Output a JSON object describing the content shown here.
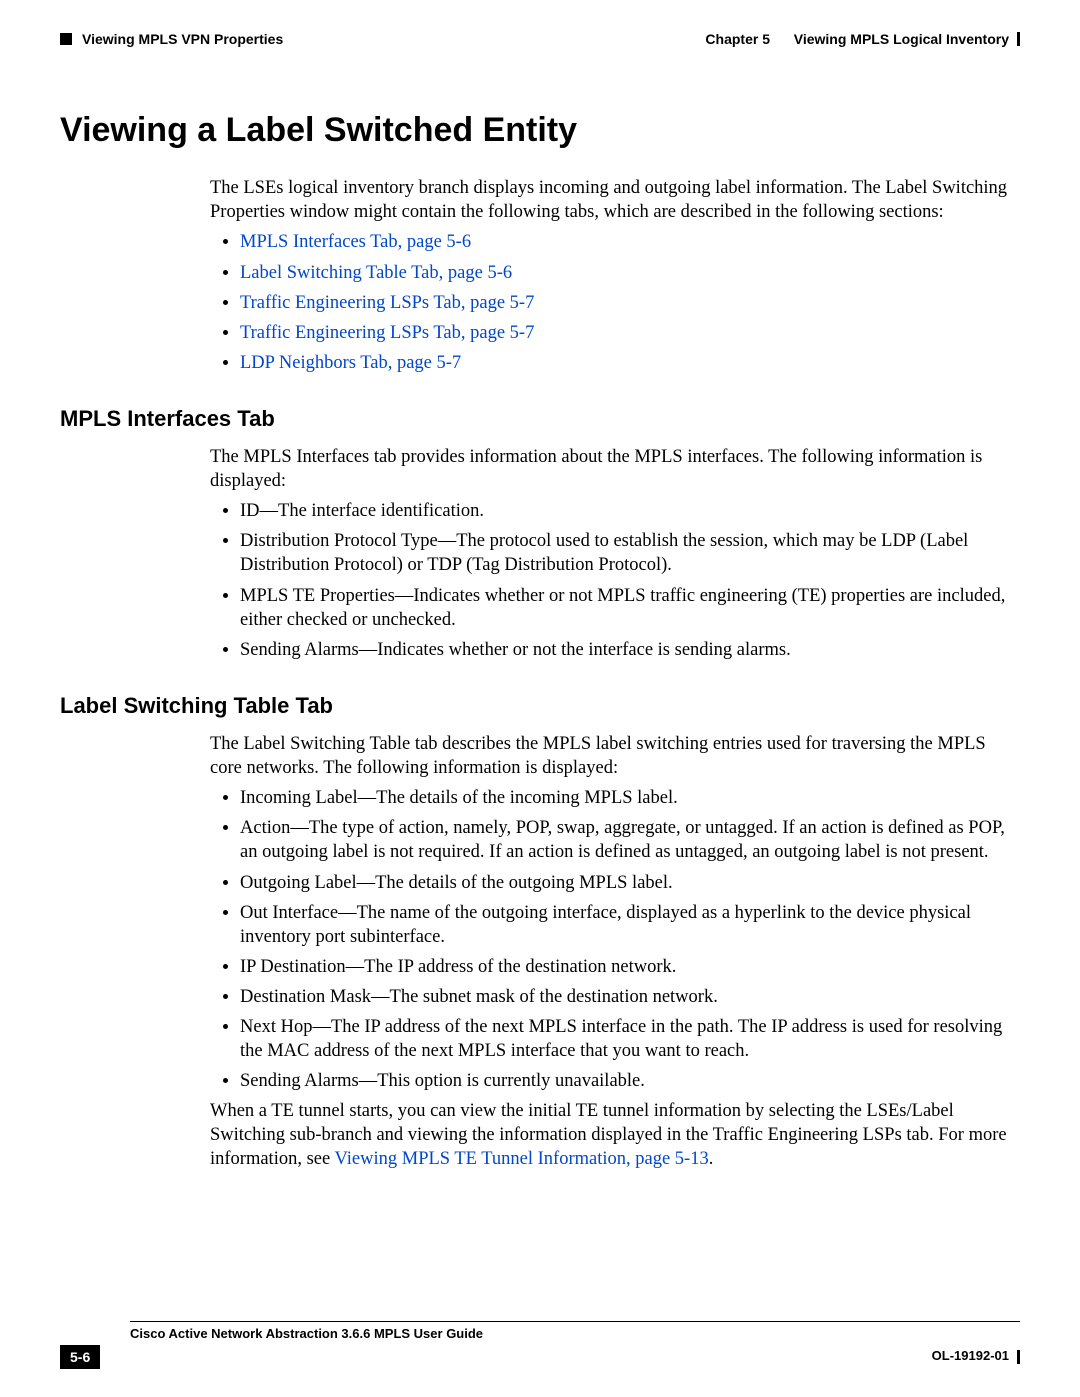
{
  "header": {
    "left": "Viewing MPLS VPN Properties",
    "chapter": "Chapter 5",
    "right": "Viewing MPLS Logical Inventory"
  },
  "title": "Viewing a Label Switched Entity",
  "intro": "The LSEs logical inventory branch displays incoming and outgoing label information. The Label Switching Properties window might contain the following tabs, which are described in the following sections:",
  "links": [
    "MPLS Interfaces Tab, page 5-6",
    "Label Switching Table Tab, page 5-6",
    "Traffic Engineering LSPs Tab, page 5-7",
    "Traffic Engineering LSPs Tab, page 5-7",
    "LDP Neighbors Tab, page 5-7"
  ],
  "section1": {
    "heading": "MPLS Interfaces Tab",
    "intro": "The MPLS Interfaces tab provides information about the MPLS interfaces. The following information is displayed:",
    "items": [
      "ID—The interface identification.",
      "Distribution Protocol Type—The protocol used to establish the session, which may be LDP (Label Distribution Protocol) or TDP (Tag Distribution Protocol).",
      "MPLS TE Properties—Indicates whether or not MPLS traffic engineering (TE) properties are included, either checked or unchecked.",
      "Sending Alarms—Indicates whether or not the interface is sending alarms."
    ]
  },
  "section2": {
    "heading": "Label Switching Table Tab",
    "intro": "The Label Switching Table tab describes the MPLS label switching entries used for traversing the MPLS core networks. The following information is displayed:",
    "items": [
      "Incoming Label—The details of the incoming MPLS label.",
      "Action—The type of action, namely, POP, swap, aggregate, or untagged. If an action is defined as POP, an outgoing label is not required. If an action is defined as untagged, an outgoing label is not present.",
      "Outgoing Label—The details of the outgoing MPLS label.",
      "Out Interface—The name of the outgoing interface, displayed as a hyperlink to the device physical inventory port subinterface.",
      "IP Destination—The IP address of the destination network.",
      "Destination Mask—The subnet mask of the destination network.",
      "Next Hop—The IP address of the next MPLS interface in the path. The IP address is used for resolving the MAC address of the next MPLS interface that you want to reach.",
      "Sending Alarms—This option is currently unavailable."
    ],
    "closing_pre": "When a TE tunnel starts, you can view the initial TE tunnel information by selecting the LSEs/Label Switching sub-branch and viewing the information displayed in the Traffic Engineering LSPs tab. For more information, see ",
    "closing_link": "Viewing MPLS TE Tunnel Information, page 5-13",
    "closing_post": "."
  },
  "footer": {
    "guide": "Cisco Active Network Abstraction 3.6.6 MPLS User Guide",
    "page": "5-6",
    "docid": "OL-19192-01"
  }
}
